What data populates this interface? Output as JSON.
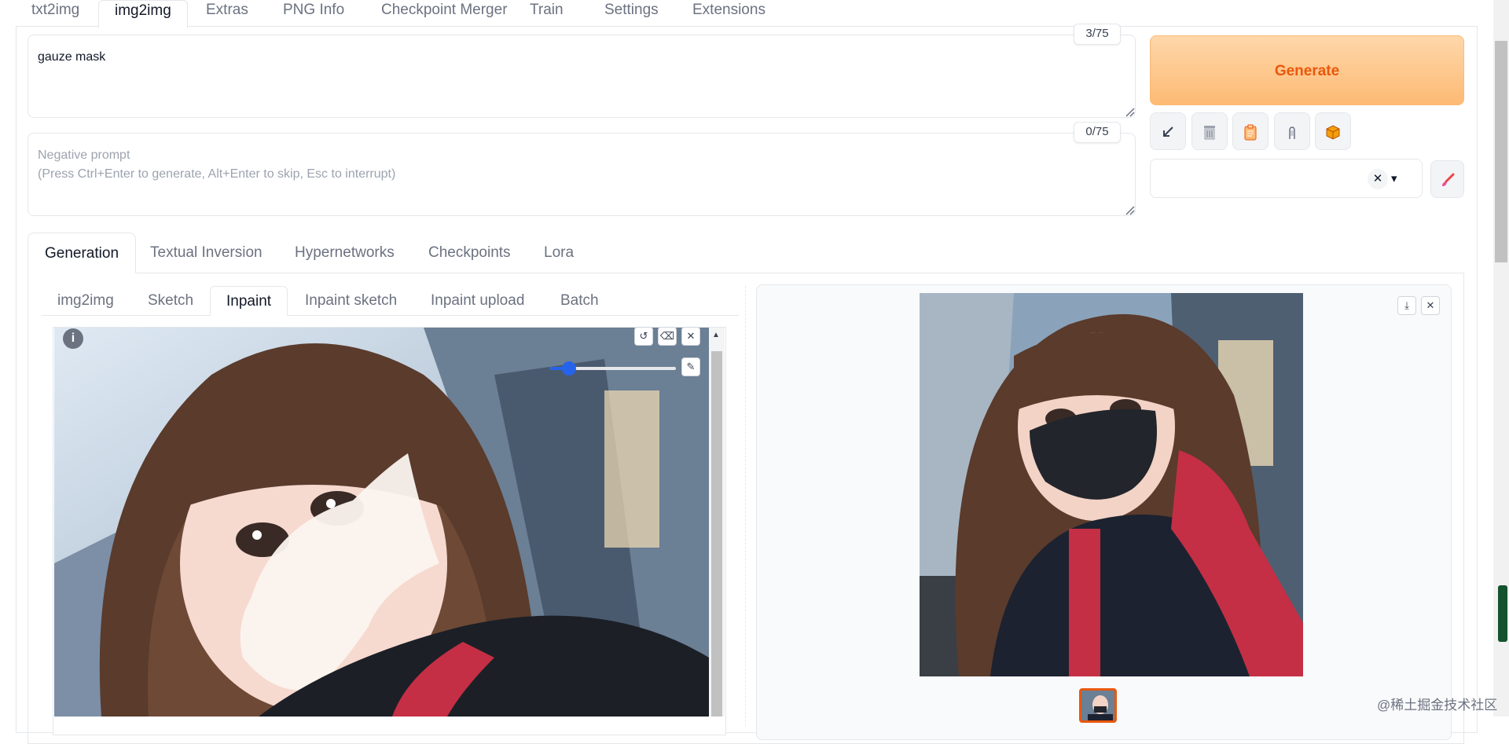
{
  "top_tabs": [
    "txt2img",
    "img2img",
    "Extras",
    "PNG Info",
    "Checkpoint Merger",
    "Train",
    "Settings",
    "Extensions"
  ],
  "prompt": {
    "value": "gauze mask",
    "counter": "3/75"
  },
  "negative_prompt": {
    "placeholder_line1": "Negative prompt",
    "placeholder_line2": "(Press Ctrl+Enter to generate, Alt+Enter to skip, Esc to interrupt)",
    "counter": "0/75"
  },
  "generate_label": "Generate",
  "tool_buttons": [
    "arrow-in-icon",
    "trash-icon",
    "clipboard-icon",
    "save-style-icon",
    "package-icon"
  ],
  "style_select": {
    "clear": "✕",
    "arrow": "▾"
  },
  "gen_tabs": [
    "Generation",
    "Textual Inversion",
    "Hypernetworks",
    "Checkpoints",
    "Lora"
  ],
  "sub_tabs": [
    "img2img",
    "Sketch",
    "Inpaint",
    "Inpaint sketch",
    "Inpaint upload",
    "Batch"
  ],
  "canvas": {
    "info": "i",
    "brush_size_fraction": 0.15
  },
  "watermark": "@稀土掘金技术社区",
  "colors": {
    "accent": "#ea580c",
    "generate_from": "#fed7aa",
    "generate_to": "#fdba74",
    "slider": "#2563eb"
  }
}
